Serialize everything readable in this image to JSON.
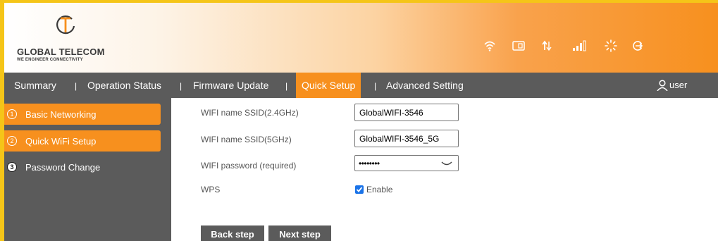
{
  "brand": {
    "name": "GLOBAL TELECOM",
    "tagline": "WE ENGINEER CONNECTIVITY",
    "colors": {
      "accent": "#f7901e",
      "nav_bg": "#5b5b5b",
      "frame": "#f5c518",
      "checkbox": "#1a73e8"
    }
  },
  "status_icons": [
    "wifi-icon",
    "sim-card-icon",
    "data-transfer-icon",
    "signal-strength-icon",
    "loading-icon",
    "logout-icon"
  ],
  "nav": {
    "items": [
      {
        "label": "Summary",
        "active": false
      },
      {
        "label": "Operation Status",
        "active": false
      },
      {
        "label": "Firmware Update",
        "active": false
      },
      {
        "label": "Quick Setup",
        "active": true
      },
      {
        "label": "Advanced Setting",
        "active": false
      }
    ],
    "separator": "|",
    "user_label": "user"
  },
  "sidebar": {
    "items": [
      {
        "num": "1",
        "label": "Basic Networking",
        "highlighted": true
      },
      {
        "num": "2",
        "label": "Quick WiFi Setup",
        "highlighted": true
      },
      {
        "num": "3",
        "label": "Password Change",
        "highlighted": false
      }
    ]
  },
  "form": {
    "ssid24_label": "WIFI name SSID(2.4GHz)",
    "ssid24_value": "GlobalWIFI-3546",
    "ssid5_label": "WIFI name SSID(5GHz)",
    "ssid5_value": "GlobalWIFI-3546_5G",
    "password_label": "WIFI password (required)",
    "password_mask": "••••••••",
    "wps_label": "WPS",
    "wps_enable_label": "Enable",
    "wps_checked": true
  },
  "buttons": {
    "back": "Back step",
    "next": "Next step"
  }
}
